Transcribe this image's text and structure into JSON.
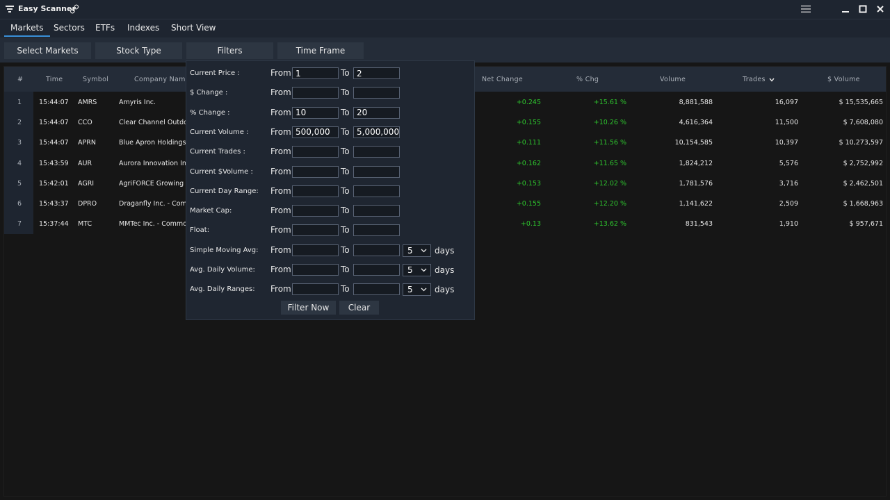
{
  "app": {
    "title": "Easy Scanner",
    "icons": [
      "filter-icon",
      "link-icon",
      "menu-icon",
      "minimize-icon",
      "maximize-icon",
      "close-icon"
    ]
  },
  "nav": {
    "tabs": [
      {
        "label": "Markets",
        "active": true
      },
      {
        "label": "Sectors"
      },
      {
        "label": "ETFs"
      },
      {
        "label": "Indexes"
      },
      {
        "label": "Short View"
      }
    ]
  },
  "toolbar": {
    "buttons": [
      "Select Markets",
      "Stock Type",
      "Filters",
      "Time Frame"
    ]
  },
  "table": {
    "columns": [
      "#",
      "Time",
      "Symbol",
      "Company Name",
      "Net Change",
      "% Chg",
      "Volume",
      "Trades",
      "$ Volume"
    ],
    "sort_column": "Trades",
    "rows": [
      {
        "n": "1",
        "time": "15:44:07",
        "symbol": "AMRS",
        "company": "Amyris Inc.",
        "net": "+0.245",
        "pct": "+15.61 %",
        "volume": "8,881,588",
        "trades": "16,097",
        "dvol": "$ 15,535,665"
      },
      {
        "n": "2",
        "time": "15:44:07",
        "symbol": "CCO",
        "company": "Clear Channel Outdo",
        "net": "+0.155",
        "pct": "+10.26 %",
        "volume": "4,616,364",
        "trades": "11,500",
        "dvol": "$ 7,608,080"
      },
      {
        "n": "3",
        "time": "15:44:07",
        "symbol": "APRN",
        "company": "Blue Apron Holdings",
        "net": "+0.111",
        "pct": "+11.56 %",
        "volume": "10,154,585",
        "trades": "10,397",
        "dvol": "$ 10,273,597"
      },
      {
        "n": "4",
        "time": "15:43:59",
        "symbol": "AUR",
        "company": "Aurora Innovation In",
        "net": "+0.162",
        "pct": "+11.65 %",
        "volume": "1,824,212",
        "trades": "5,576",
        "dvol": "$ 2,752,992"
      },
      {
        "n": "5",
        "time": "15:42:01",
        "symbol": "AGRI",
        "company": "AgriFORCE  Growing",
        "net": "+0.153",
        "pct": "+12.02 %",
        "volume": "1,781,576",
        "trades": "3,716",
        "dvol": "$ 2,462,501"
      },
      {
        "n": "6",
        "time": "15:43:37",
        "symbol": "DPRO",
        "company": "Draganfly Inc. - Com",
        "net": "+0.155",
        "pct": "+12.20 %",
        "volume": "1,141,622",
        "trades": "2,509",
        "dvol": "$ 1,668,963"
      },
      {
        "n": "7",
        "time": "15:37:44",
        "symbol": "MTC",
        "company": "MMTec Inc. - Commo",
        "net": "+0.13",
        "pct": "+13.62 %",
        "volume": "831,543",
        "trades": "1,910",
        "dvol": "$ 957,671"
      }
    ]
  },
  "filters": {
    "from_label": "From",
    "to_label": "To",
    "days_label": "days",
    "rows": [
      {
        "label": "Current Price :",
        "from": "1",
        "to": "2"
      },
      {
        "label": "$ Change :",
        "from": "",
        "to": ""
      },
      {
        "label": "% Change :",
        "from": "10",
        "to": "20"
      },
      {
        "label": "Current Volume :",
        "from": "500,000",
        "to": "5,000,000"
      },
      {
        "label": "Current Trades :",
        "from": "",
        "to": ""
      },
      {
        "label": "Current $Volume :",
        "from": "",
        "to": ""
      },
      {
        "label": "Current Day Range:",
        "from": "",
        "to": ""
      },
      {
        "label": "Market Cap:",
        "from": "",
        "to": ""
      },
      {
        "label": "Float:",
        "from": "",
        "to": ""
      },
      {
        "label": "Simple Moving Avg:",
        "from": "",
        "to": "",
        "days": "5"
      },
      {
        "label": "Avg. Daily Volume:",
        "from": "",
        "to": "",
        "days": "5"
      },
      {
        "label": "Avg. Daily Ranges:",
        "from": "",
        "to": "",
        "days": "5"
      }
    ],
    "filter_now_label": "Filter Now",
    "clear_label": "Clear"
  },
  "colors": {
    "accent": "#3a8fd8",
    "positive": "#2ec52e",
    "titlebar": "#1e2530",
    "background": "#161616"
  }
}
